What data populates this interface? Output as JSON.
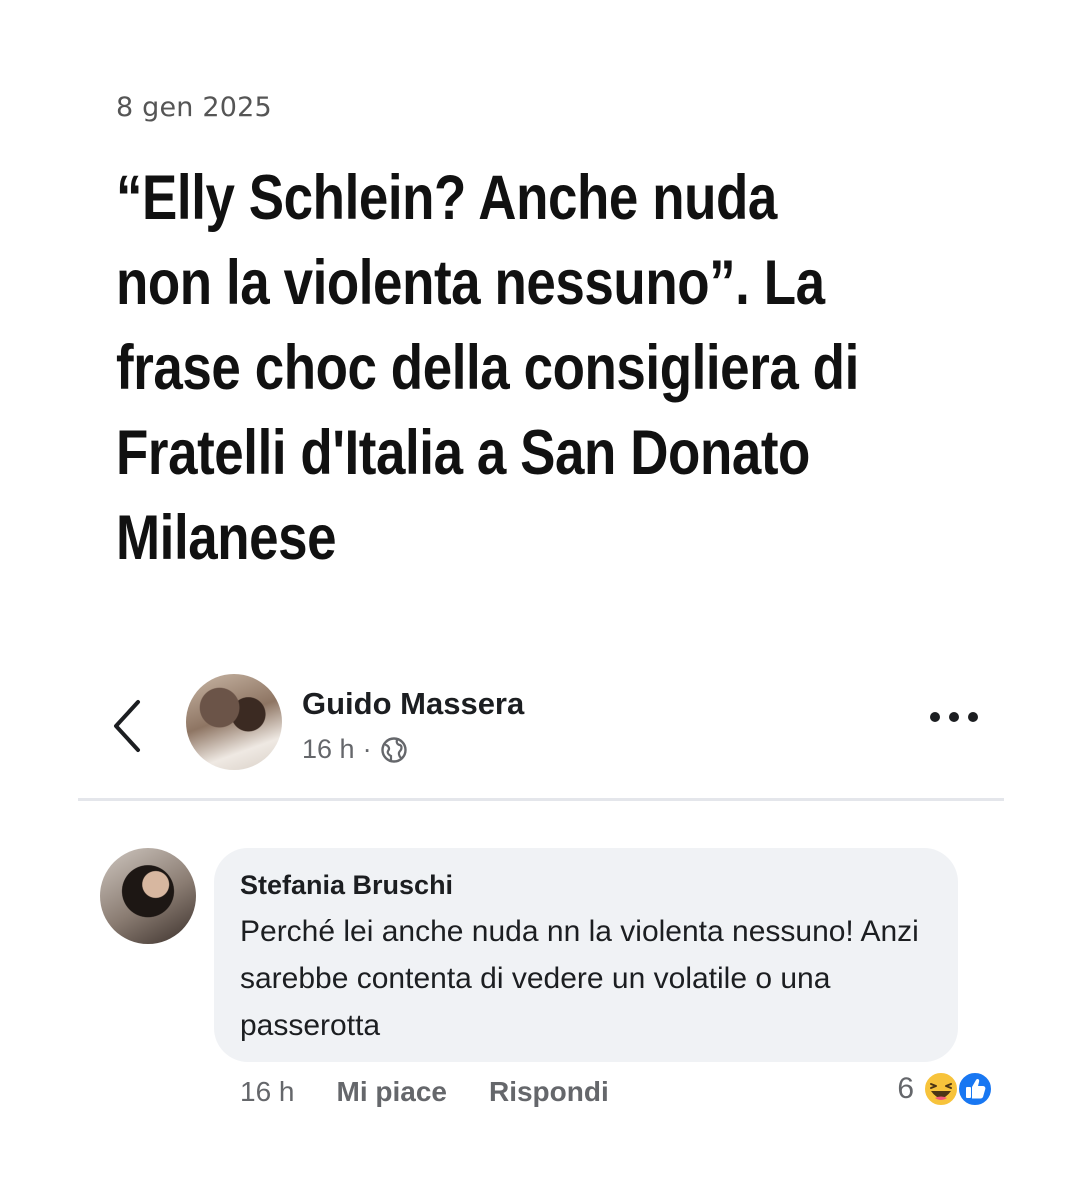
{
  "article": {
    "date": "8 gen 2025",
    "headline": "“Elly Schlein? Anche nuda non la violenta nessuno”. La frase choc della consigliera di Fratelli d'Italia a San Donato Milanese"
  },
  "post": {
    "author": "Guido Massera",
    "time": "16 h",
    "separator": "·",
    "audience_icon": "globe-icon"
  },
  "comment": {
    "author": "Stefania Bruschi",
    "text": "Perché lei anche nuda nn la violenta nessuno! Anzi sarebbe contenta di vedere un volatile o una passerotta",
    "time": "16 h",
    "like_label": "Mi piace",
    "reply_label": "Rispondi",
    "reaction_count": "6",
    "reactions": [
      "haha-icon",
      "like-icon"
    ]
  },
  "colors": {
    "fb_blue": "#1877f2",
    "bubble": "#f0f2f5",
    "meta_text": "#65676b"
  }
}
